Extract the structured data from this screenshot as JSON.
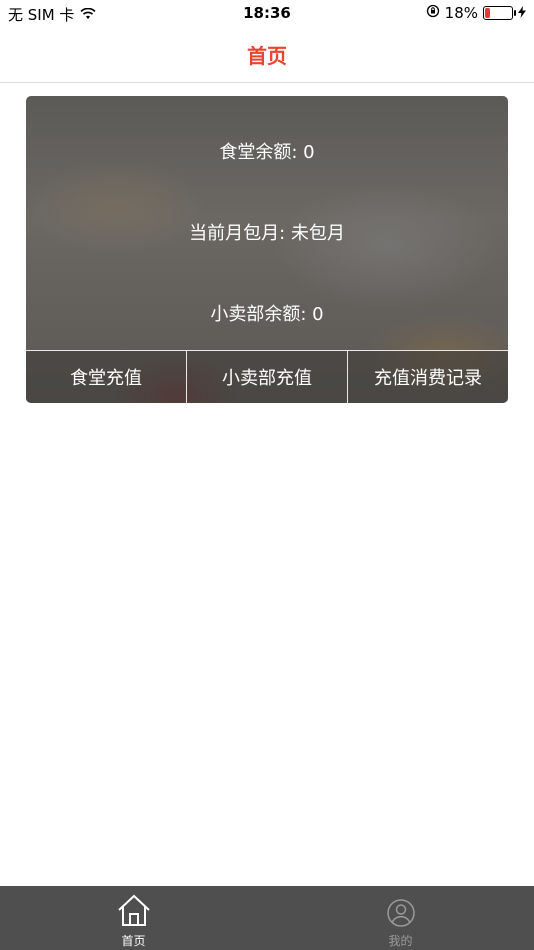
{
  "status_bar": {
    "carrier": "无 SIM 卡",
    "time": "18:36",
    "battery": "18%",
    "battery_level": 0.18
  },
  "nav": {
    "title": "首页"
  },
  "card": {
    "canteen_balance": "食堂余额: 0",
    "monthly_plan": "当前月包月: 未包月",
    "shop_balance": "小卖部余额: 0",
    "actions": [
      "食堂充值",
      "小卖部充值",
      "充值消费记录"
    ]
  },
  "tabbar": {
    "items": [
      {
        "label": "首页",
        "icon": "home-icon",
        "active": true
      },
      {
        "label": "我的",
        "icon": "user-icon",
        "active": false
      }
    ],
    "active_color": "#ffffff",
    "inactive_color": "#9a9a9a"
  },
  "colors": {
    "accent": "#e8452f",
    "tabbar_bg": "#4f4f4f"
  }
}
